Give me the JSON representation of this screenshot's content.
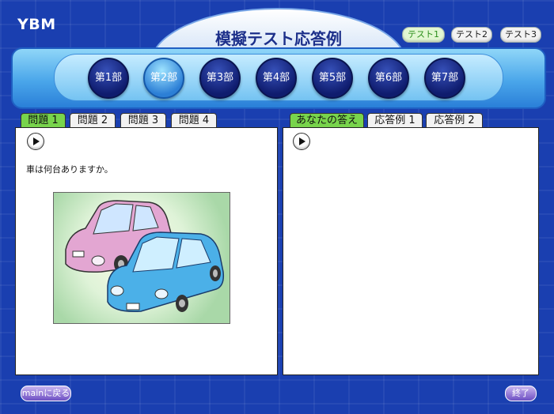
{
  "header": {
    "logo": "YBM",
    "title": "模擬テスト応答例",
    "test_tabs": [
      {
        "label": "テスト1"
      },
      {
        "label": "テスト2"
      },
      {
        "label": "テスト3"
      }
    ]
  },
  "parts": [
    {
      "label": "第1部"
    },
    {
      "label": "第2部"
    },
    {
      "label": "第3部"
    },
    {
      "label": "第4部"
    },
    {
      "label": "第5部"
    },
    {
      "label": "第6部"
    },
    {
      "label": "第7部"
    }
  ],
  "left_panel": {
    "tabs": [
      {
        "label": "問題 1"
      },
      {
        "label": "問題 2"
      },
      {
        "label": "問題 3"
      },
      {
        "label": "問題 4"
      }
    ],
    "question": "車は何台ありますか。"
  },
  "right_panel": {
    "tabs": [
      {
        "label": "あなたの答え"
      },
      {
        "label": "応答例 1"
      },
      {
        "label": "応答例 2"
      }
    ]
  },
  "footer": {
    "main_button": "mainに戻る",
    "exit_button": "終了"
  },
  "colors": {
    "background": "#1a3fb0",
    "active_tab": "#78d44c",
    "part_active": "#2c7fd6",
    "part_inactive": "#0f1c6e"
  }
}
